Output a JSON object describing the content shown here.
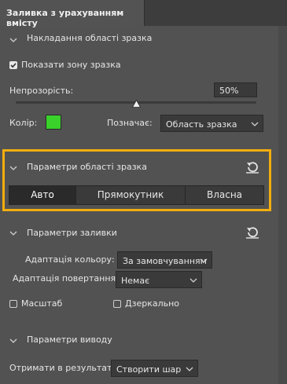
{
  "window": {
    "tab_title": "Заливка з урахуванням вмісту"
  },
  "section_sampling_area_overlay": {
    "title": "Накладання області зразка",
    "show_sample_area_label": "Показати зону зразка",
    "show_sample_area_checked": true,
    "opacity_label": "Непрозорість:",
    "opacity_value": "50%",
    "opacity_fraction": 0.5,
    "color_label": "Колір:",
    "color_value": "#39d12a",
    "indicates_label": "Позначає:",
    "indicates_value": "Область зразка"
  },
  "section_sampling_area_options": {
    "title": "Параметри області зразка",
    "segments": [
      "Авто",
      "Прямокутник",
      "Власна"
    ],
    "active_segment": "Авто",
    "highlight_color": "#f2ad0e"
  },
  "section_fill_settings": {
    "title": "Параметри заливки",
    "color_adaptation_label": "Адаптація кольору:",
    "color_adaptation_value": "За замовчуванням",
    "rotation_adaptation_label": "Адаптація повертання:",
    "rotation_adaptation_value": "Немає",
    "scale_label": "Масштаб",
    "scale_checked": false,
    "mirror_label": "Дзеркально",
    "mirror_checked": false
  },
  "section_output_settings": {
    "title": "Параметри виводу",
    "output_label": "Отримати в результаті:",
    "output_value": "Створити шар"
  }
}
